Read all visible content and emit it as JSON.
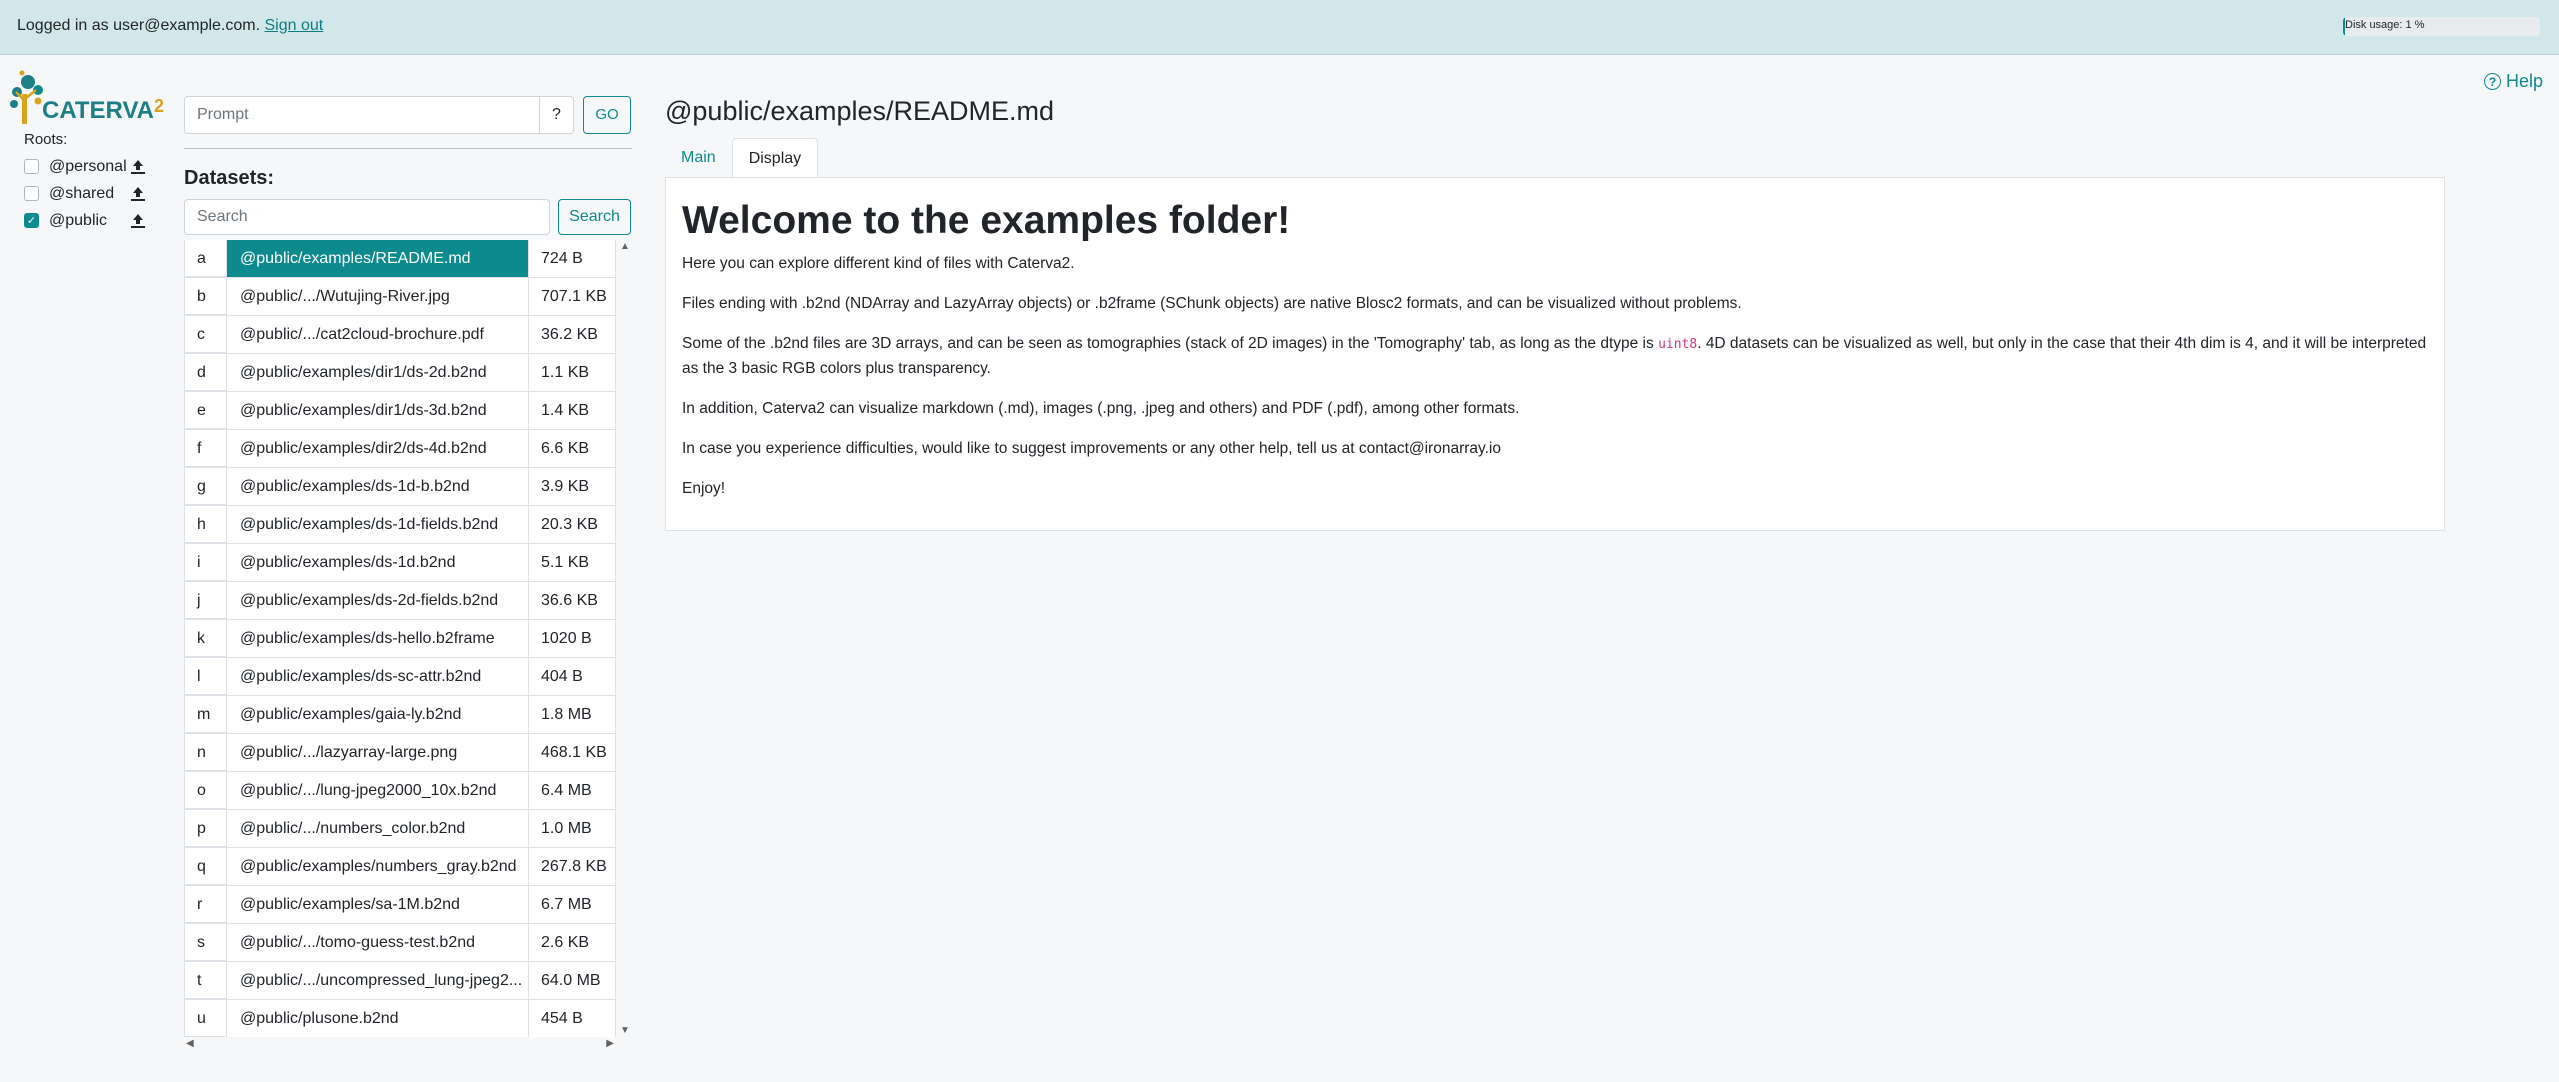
{
  "header": {
    "login_prefix": "Logged in as user@example.com.",
    "sign_out": "Sign out",
    "disk_usage_label": "Disk usage: 1 %",
    "disk_usage_fraction": 0.01
  },
  "help": {
    "label": "Help",
    "icon": "question-circle-icon"
  },
  "logo": {
    "text": "CATERVA",
    "suffix": "2"
  },
  "roots": {
    "title": "Roots:",
    "items": [
      {
        "label": "@personal",
        "checked": false
      },
      {
        "label": "@shared",
        "checked": false
      },
      {
        "label": "@public",
        "checked": true
      }
    ]
  },
  "prompt": {
    "placeholder": "Prompt",
    "help_label": "?",
    "go_label": "GO"
  },
  "datasets": {
    "title": "Datasets:",
    "search_placeholder": "Search",
    "search_button": "Search",
    "rows": [
      {
        "key": "a",
        "name": "@public/examples/README.md",
        "size": "724 B",
        "active": true
      },
      {
        "key": "b",
        "name": "@public/.../Wutujing-River.jpg",
        "size": "707.1 KB"
      },
      {
        "key": "c",
        "name": "@public/.../cat2cloud-brochure.pdf",
        "size": "36.2 KB"
      },
      {
        "key": "d",
        "name": "@public/examples/dir1/ds-2d.b2nd",
        "size": "1.1 KB"
      },
      {
        "key": "e",
        "name": "@public/examples/dir1/ds-3d.b2nd",
        "size": "1.4 KB"
      },
      {
        "key": "f",
        "name": "@public/examples/dir2/ds-4d.b2nd",
        "size": "6.6 KB"
      },
      {
        "key": "g",
        "name": "@public/examples/ds-1d-b.b2nd",
        "size": "3.9 KB"
      },
      {
        "key": "h",
        "name": "@public/examples/ds-1d-fields.b2nd",
        "size": "20.3 KB"
      },
      {
        "key": "i",
        "name": "@public/examples/ds-1d.b2nd",
        "size": "5.1 KB"
      },
      {
        "key": "j",
        "name": "@public/examples/ds-2d-fields.b2nd",
        "size": "36.6 KB"
      },
      {
        "key": "k",
        "name": "@public/examples/ds-hello.b2frame",
        "size": "1020 B"
      },
      {
        "key": "l",
        "name": "@public/examples/ds-sc-attr.b2nd",
        "size": "404 B"
      },
      {
        "key": "m",
        "name": "@public/examples/gaia-ly.b2nd",
        "size": "1.8 MB"
      },
      {
        "key": "n",
        "name": "@public/.../lazyarray-large.png",
        "size": "468.1 KB"
      },
      {
        "key": "o",
        "name": "@public/.../lung-jpeg2000_10x.b2nd",
        "size": "6.4 MB"
      },
      {
        "key": "p",
        "name": "@public/.../numbers_color.b2nd",
        "size": "1.0 MB"
      },
      {
        "key": "q",
        "name": "@public/examples/numbers_gray.b2nd",
        "size": "267.8 KB"
      },
      {
        "key": "r",
        "name": "@public/examples/sa-1M.b2nd",
        "size": "6.7 MB"
      },
      {
        "key": "s",
        "name": "@public/.../tomo-guess-test.b2nd",
        "size": "2.6 KB"
      },
      {
        "key": "t",
        "name": "@public/.../uncompressed_lung-jpeg2...",
        "size": "64.0 MB"
      },
      {
        "key": "u",
        "name": "@public/plusone.b2nd",
        "size": "454 B"
      }
    ]
  },
  "main": {
    "title": "@public/examples/README.md",
    "tabs": [
      {
        "label": "Main",
        "active": false
      },
      {
        "label": "Display",
        "active": true
      }
    ],
    "heading": "Welcome to the examples folder!",
    "p1": "Here you can explore different kind of files with Caterva2.",
    "p2": "Files ending with .b2nd (NDArray and LazyArray objects) or .b2frame (SChunk objects) are native Blosc2 formats, and can be visualized without problems.",
    "p3_before": "Some of the .b2nd files are 3D arrays, and can be seen as tomographies (stack of 2D images) in the 'Tomography' tab, as long as the dtype is ",
    "p3_code": "uint8",
    "p3_after": ". 4D datasets can be visualized as well, but only in the case that their 4th dim is 4, and it will be interpreted as the 3 basic RGB colors plus transparency.",
    "p4": "In addition, Caterva2 can visualize markdown (.md), images (.png, .jpeg and others) and PDF (.pdf), among other formats.",
    "p5": "In case you experience difficulties, would like to suggest improvements or any other help, tell us at contact@ironarray.io",
    "p6": "Enjoy!"
  },
  "colors": {
    "accent": "#0d8a8e",
    "banner": "#d1e7ea",
    "logo_gold": "#d9a31c"
  }
}
